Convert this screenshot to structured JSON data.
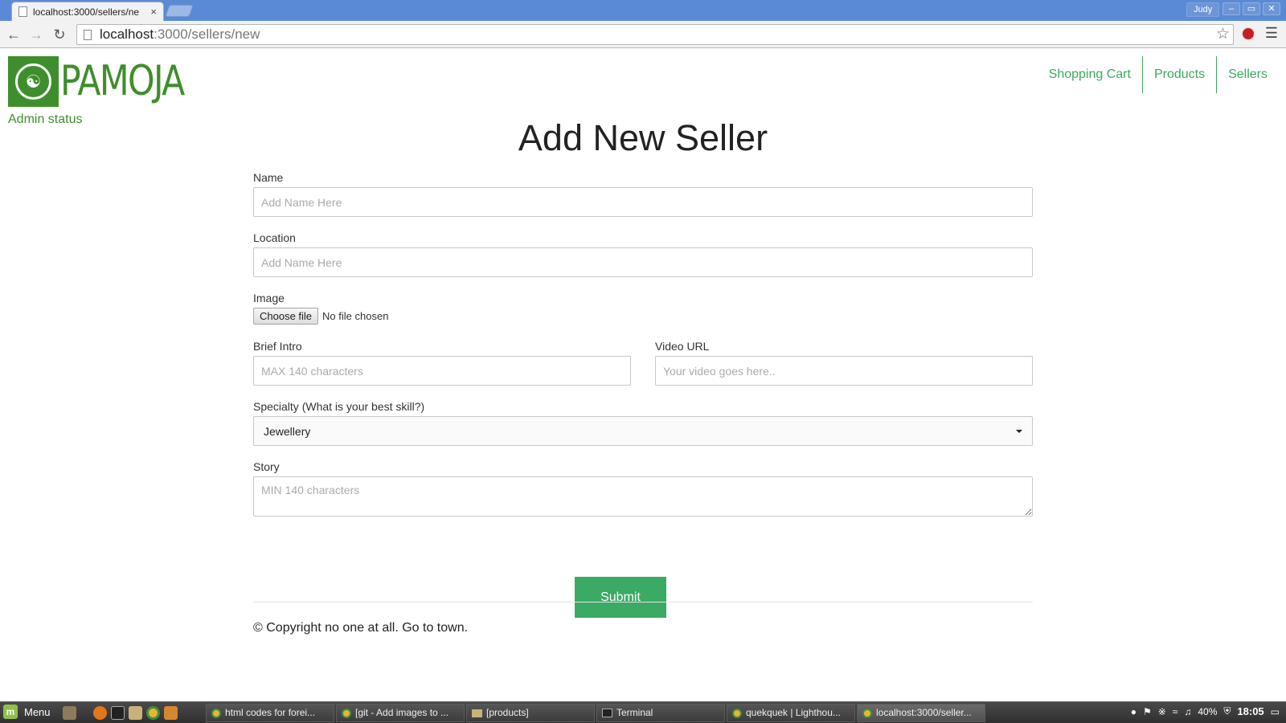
{
  "browser": {
    "tab_title": "localhost:3000/sellers/ne",
    "tab_close": "×",
    "user": "Judy",
    "url_host": "localhost",
    "url_path": ":3000/sellers/new",
    "window_buttons": [
      "–",
      "▭",
      "✕"
    ]
  },
  "site": {
    "logo_text": "PAMOJA",
    "admin_status": "Admin status",
    "nav": [
      "Shopping Cart",
      "Products",
      "Sellers"
    ]
  },
  "form": {
    "title": "Add New Seller",
    "name_label": "Name",
    "name_placeholder": "Add Name Here",
    "location_label": "Location",
    "location_placeholder": "Add Name Here",
    "image_label": "Image",
    "choose_file": "Choose file",
    "file_status": "No file chosen",
    "intro_label": "Brief Intro",
    "intro_placeholder": "MAX 140 characters",
    "video_label": "Video URL",
    "video_placeholder": "Your video goes here..",
    "specialty_label": "Specialty (What is your best skill?)",
    "specialty_value": "Jewellery",
    "story_label": "Story",
    "story_placeholder": "MIN 140 characters",
    "submit": "Submit"
  },
  "footer": {
    "text": "© Copyright no one at all. Go to town."
  },
  "taskbar": {
    "menu": "Menu",
    "tasks": [
      "html codes for forei...",
      "[git - Add images to ...",
      "[products]",
      "Terminal",
      "quekquek | Lighthou...",
      "localhost:3000/seller..."
    ],
    "battery": "40%",
    "clock": "18:05"
  }
}
